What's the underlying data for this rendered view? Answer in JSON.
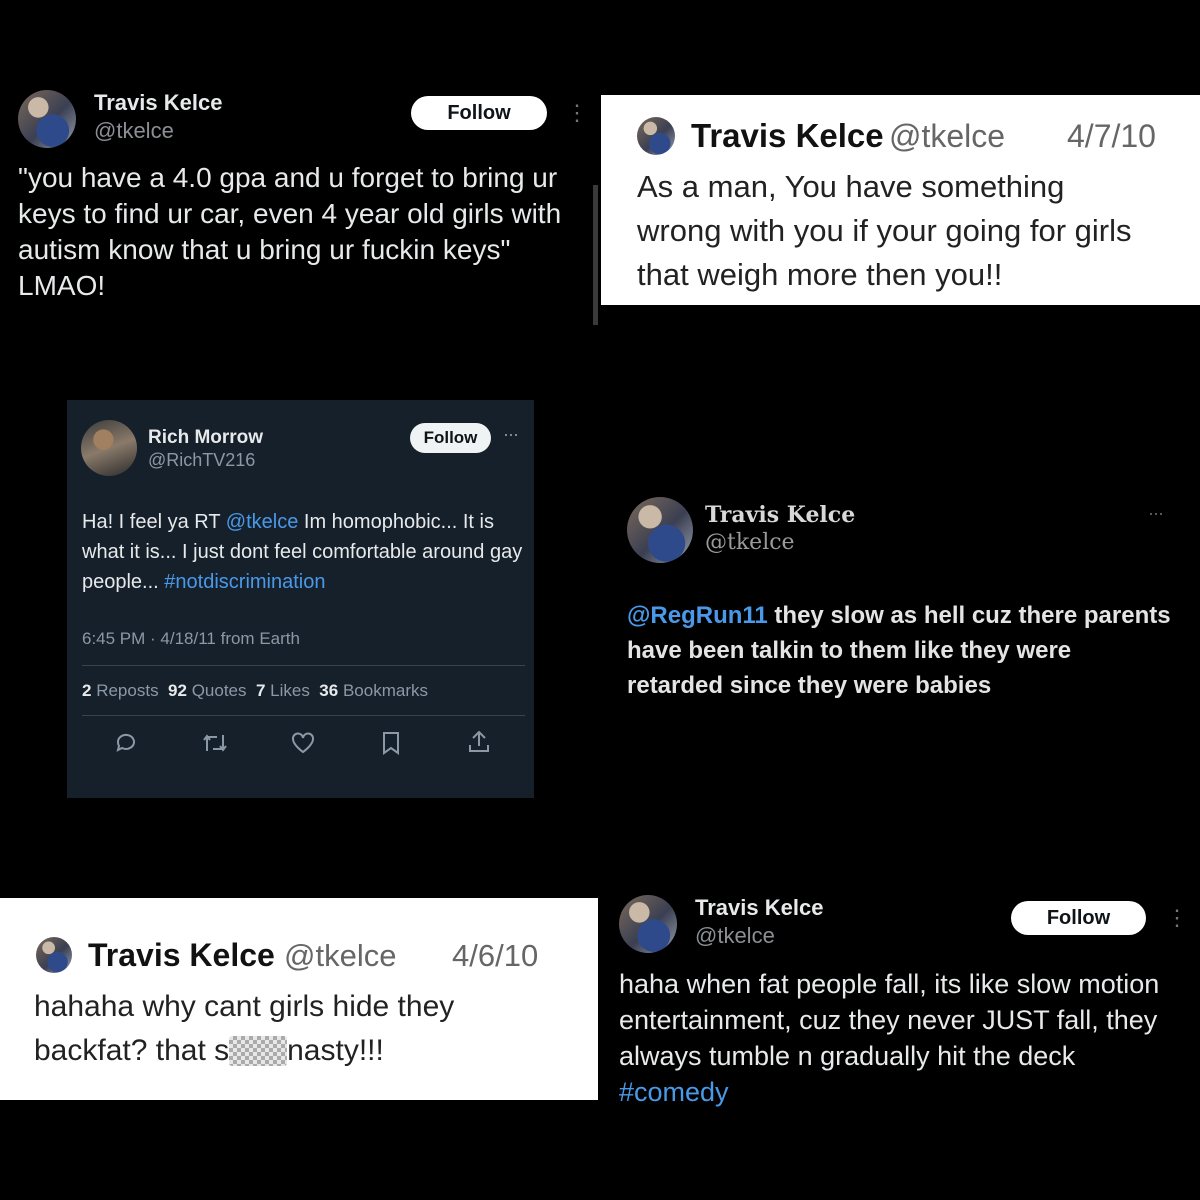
{
  "panel1": {
    "name": "Travis Kelce",
    "handle": "@tkelce",
    "follow_label": "Follow",
    "text": "\"you have a 4.0 gpa and u forget to bring ur keys to find ur car, even 4 year old girls with autism know that u bring ur fuckin keys\" LMAO!"
  },
  "panel2": {
    "name": "Travis Kelce",
    "handle": "@tkelce",
    "date": "4/7/10",
    "text": "As a man, You have something wrong with you if your going for girls that weigh more then you!!"
  },
  "panel3": {
    "name": "Rich Morrow",
    "handle": "@RichTV216",
    "follow_label": "Follow",
    "text_pre": "Ha! I feel ya RT ",
    "mention": "@tkelce",
    "text_mid": " Im homophobic... It is what it is... I just dont feel comfortable around gay people... ",
    "hashtag": "#notdiscrimination",
    "meta": "6:45 PM · 4/18/11 from Earth",
    "stats": [
      {
        "count": "2",
        "label": "Reposts"
      },
      {
        "count": "92",
        "label": "Quotes"
      },
      {
        "count": "7",
        "label": "Likes"
      },
      {
        "count": "36",
        "label": "Bookmarks"
      }
    ],
    "actions": [
      "reply-icon",
      "repost-icon",
      "like-icon",
      "bookmark-icon",
      "share-icon"
    ]
  },
  "panel4": {
    "name": "Travis Kelce",
    "handle": "@tkelce",
    "mention": "@RegRun11",
    "text": " they slow as hell cuz there parents have been talkin to them like they were retarded since they were babies"
  },
  "panel5": {
    "name": "Travis Kelce",
    "handle": "@tkelce",
    "date": "4/6/10",
    "text_pre": "hahaha why cant girls hide they backfat? that s",
    "text_post": "nasty!!!"
  },
  "panel6": {
    "name": "Travis Kelce",
    "handle": "@tkelce",
    "follow_label": "Follow",
    "text": "haha when fat people fall, its like slow motion entertainment, cuz they never JUST fall, they always tumble n gradually hit the deck ",
    "hashtag": "#comedy"
  },
  "colors": {
    "link": "#4a99e9",
    "dark_card": "#15202b"
  }
}
